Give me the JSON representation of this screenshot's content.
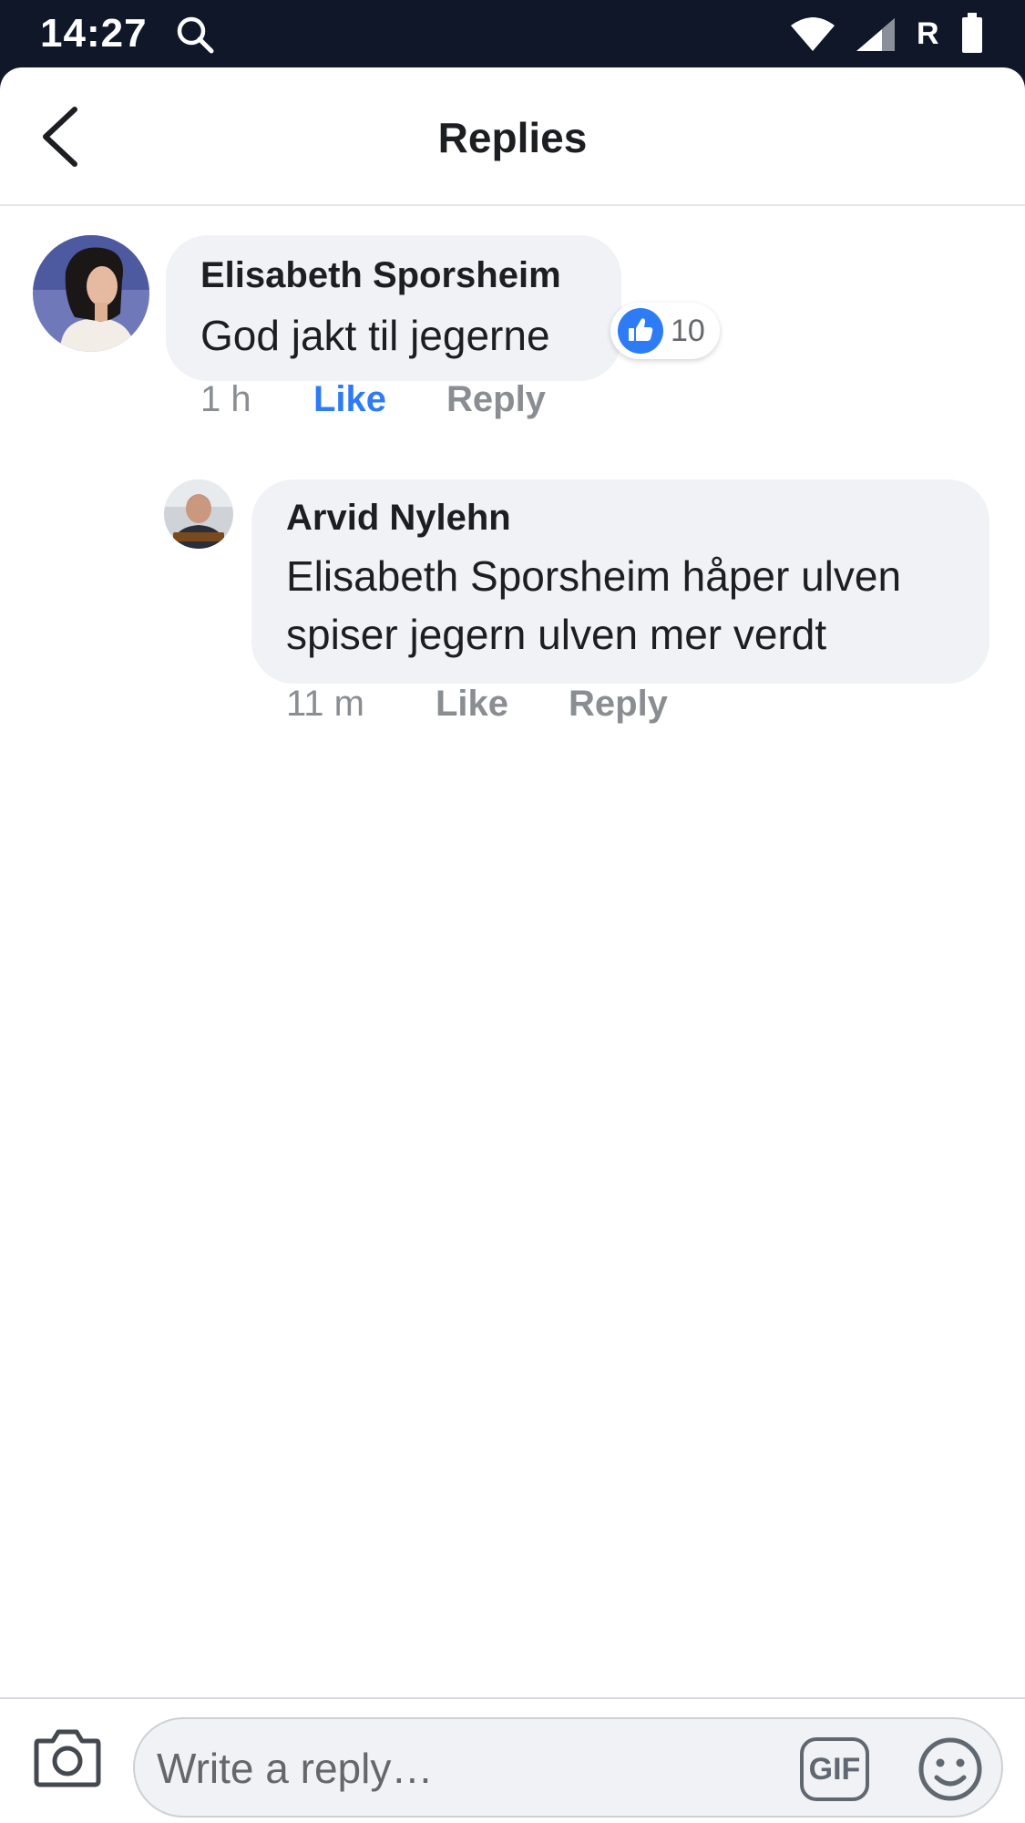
{
  "status_bar": {
    "time": "14:27",
    "carrier_letter": "R"
  },
  "header": {
    "title": "Replies"
  },
  "comments": [
    {
      "author": "Elisabeth Sporsheim",
      "text": "God jakt til jegerne",
      "reaction_count": "10",
      "time": "1 h",
      "like_label": "Like",
      "reply_label": "Reply",
      "liked": true
    },
    {
      "author": "Arvid Nylehn",
      "text_lines": [
        "Elisabeth Sporsheim håper ulven",
        "spiser jegern ulven mer verdt"
      ],
      "time": "11 m",
      "like_label": "Like",
      "reply_label": "Reply",
      "liked": false
    }
  ],
  "composer": {
    "placeholder": "Write a reply…",
    "gif_label": "GIF"
  },
  "colors": {
    "accent": "#2d7cf6",
    "status_bar": "#0f1729",
    "bubble": "#f0f2f5",
    "meta_text": "#8a8d91"
  }
}
